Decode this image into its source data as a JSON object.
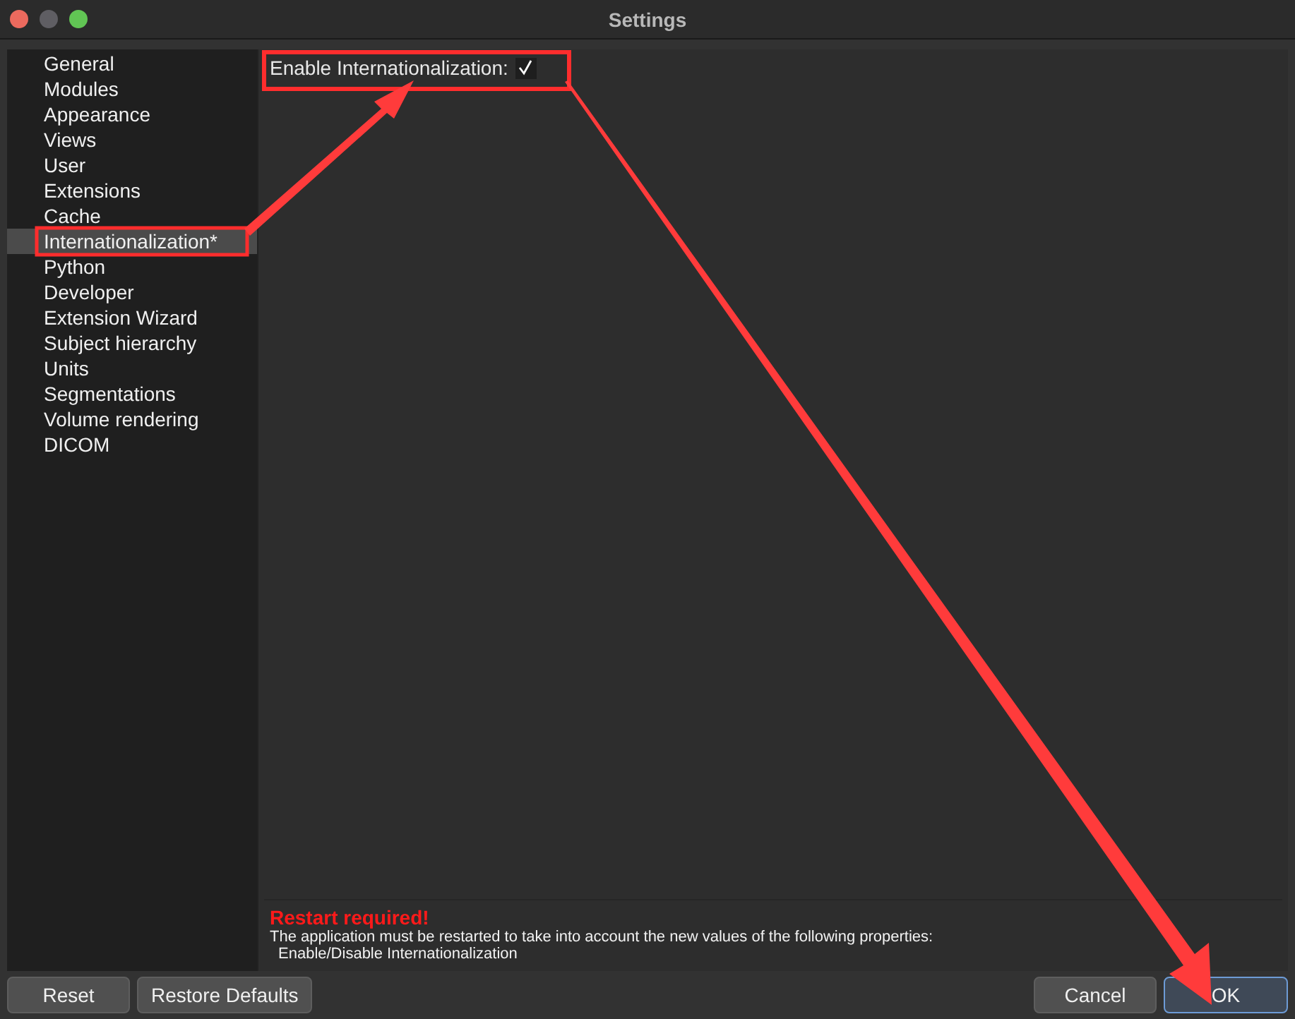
{
  "window": {
    "title": "Settings"
  },
  "sidebar": {
    "items": [
      {
        "label": "General",
        "selected": false
      },
      {
        "label": "Modules",
        "selected": false
      },
      {
        "label": "Appearance",
        "selected": false
      },
      {
        "label": "Views",
        "selected": false
      },
      {
        "label": "User",
        "selected": false
      },
      {
        "label": "Extensions",
        "selected": false
      },
      {
        "label": "Cache",
        "selected": false
      },
      {
        "label": "Internationalization*",
        "selected": true
      },
      {
        "label": "Python",
        "selected": false
      },
      {
        "label": "Developer",
        "selected": false
      },
      {
        "label": "Extension Wizard",
        "selected": false
      },
      {
        "label": "Subject hierarchy",
        "selected": false
      },
      {
        "label": "Units",
        "selected": false
      },
      {
        "label": "Segmentations",
        "selected": false
      },
      {
        "label": "Volume rendering",
        "selected": false
      },
      {
        "label": "DICOM",
        "selected": false
      }
    ]
  },
  "setting": {
    "label": "Enable Internationalization:",
    "checked": true
  },
  "message": {
    "title": "Restart required!",
    "text": "The application must be restarted to take into account the new values of the following properties:",
    "properties": [
      "Enable/Disable Internationalization"
    ]
  },
  "buttons": [
    {
      "label": "Reset",
      "default": false
    },
    {
      "label": "Restore Defaults",
      "default": false
    },
    {
      "label": "Cancel",
      "default": false
    },
    {
      "label": "OK",
      "default": true
    }
  ]
}
